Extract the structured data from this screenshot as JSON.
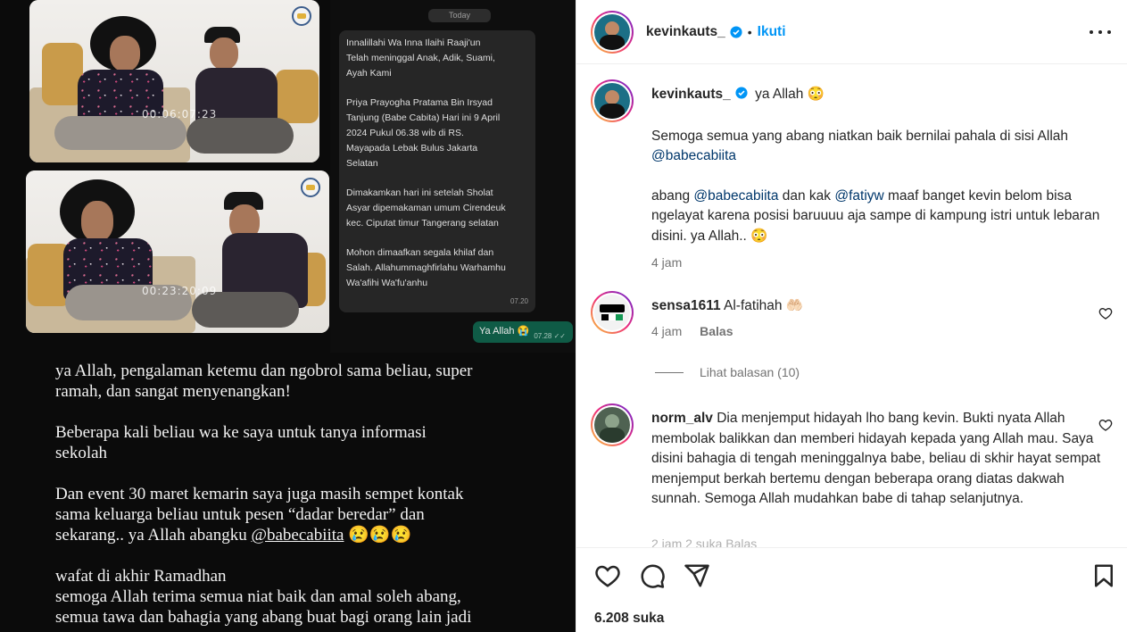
{
  "media": {
    "timecode1": "00:06:07:23",
    "timecode2": "00:23:20:09",
    "chat": {
      "date_divider": "Today",
      "incoming": [
        "Innalillahi Wa Inna Ilaihi Raaji'un\nTelah meninggal Anak, Adik, Suami,\nAyah Kami",
        "Priya Prayogha Pratama Bin Irsyad\nTanjung (Babe Cabita) Hari ini 9 April\n2024 Pukul 06.38 wib di RS.\nMayapada Lebak Bulus Jakarta\nSelatan",
        "Dimakamkan hari ini setelah Sholat\nAsyar dipemakaman umum Cirendeuk\nkec. Ciputat timur  Tangerang selatan",
        "Mohon dimaafkan segala khilaf dan\nSalah. Allahummaghfirlahu Warhamhu\nWa'afihi Wa'fu'anhu"
      ],
      "incoming_time": "07.20",
      "outgoing_text": "Ya Allah 😭",
      "outgoing_time": "07.28 ✓✓"
    },
    "story": {
      "p1": "ya Allah, pengalaman ketemu dan ngobrol sama beliau, super\nramah, dan sangat menyenangkan!",
      "p2": "Beberapa kali beliau wa ke saya untuk tanya informasi\nsekolah",
      "p3_a": "Dan event 30 maret kemarin saya juga masih sempet kontak\nsama keluarga beliau untuk pesen “dadar beredar” dan\nsekarang.. ya Allah abangku ",
      "p3_mention": "@babecabiita",
      "p3_b": " 😢😢😢",
      "p4": "wafat di akhir Ramadhan\nsemoga Allah terima semua niat baik dan amal soleh abang,\nsemua tawa dan bahagia yang abang buat bagi orang lain jadi"
    }
  },
  "header": {
    "username": "kevinkauts_",
    "separator": "•",
    "follow_label": "Ikuti"
  },
  "caption": {
    "username": "kevinkauts_",
    "first_line": "ya Allah 😳",
    "para1_a": "Semoga semua yang abang niatkan baik bernilai pahala di sisi Allah ",
    "para1_mention": "@babecabiita",
    "para2_a": "abang ",
    "para2_mention1": "@babecabiita",
    "para2_b": " dan kak ",
    "para2_mention2": "@fatiyw",
    "para2_c": " maaf banget kevin belom bisa ngelayat karena posisi baruuuu aja sampe di kampung istri untuk lebaran disini. ya Allah.. 😳",
    "time": "4 jam"
  },
  "comments": [
    {
      "username": "sensa1611",
      "text": " Al-fatihah 🤲🏻",
      "time": "4 jam",
      "reply_label": "Balas",
      "view_replies": "Lihat balasan (10)"
    },
    {
      "username": "norm_alv",
      "text": " Dia menjemput hidayah lho bang kevin. Bukti nyata Allah membolak balikkan dan memberi hidayah kepada yang Allah mau. Saya disini bahagia di tengah meninggalnya babe, beliau di skhir hayat sempat menjemput berkah bertemu dengan beberapa orang diatas dakwah sunnah. Semoga Allah mudahkan babe di tahap selanjutnya.",
      "meta_faded": "2 jam    2 suka    Balas"
    }
  ],
  "actions": {
    "likes": "6.208 suka"
  },
  "colors": {
    "follow_blue": "#0095f6",
    "mention": "#00376b",
    "text": "#262626",
    "muted": "#737373"
  },
  "icons": [
    "verified-badge-icon",
    "more-options-icon",
    "heart-icon",
    "comment-icon",
    "share-icon",
    "bookmark-icon"
  ]
}
